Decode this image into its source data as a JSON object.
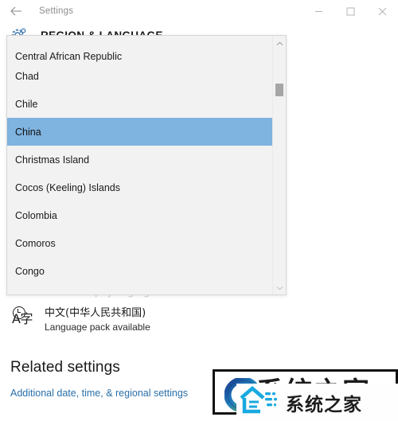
{
  "titlebar": {
    "back_icon": "back-arrow-icon",
    "app_title": "Settings",
    "minimize_icon": "minimize-icon",
    "maximize_icon": "maximize-icon",
    "close_icon": "close-icon"
  },
  "header": {
    "icon": "gear-icon",
    "title": "REGION & LANGUAGE"
  },
  "dropdown": {
    "name": "country-region-dropdown",
    "selected": "China",
    "scroll_up_icon": "chevron-up-icon",
    "scroll_down_icon": "chevron-down-icon",
    "options": [
      "Central African Republic",
      "Chad",
      "Chile",
      "China",
      "Christmas Island",
      "Cocos (Keeling) Islands",
      "Colombia",
      "Comoros",
      "Congo"
    ]
  },
  "content": {
    "clipped_row_label": "Windows display language",
    "language": {
      "icon": "language-character-icon",
      "glyph": "A字",
      "name": "中文(中华人民共和国)",
      "status": "Language pack available"
    },
    "related": {
      "heading": "Related settings",
      "link": "Additional date, time, & regional settings"
    }
  },
  "watermark": {
    "back_text": "系统之家",
    "front_text": "系统之家",
    "ring_icon": "logo-ring-icon",
    "house_icon": "logo-house-icon"
  },
  "colors": {
    "selection_blue": "#7fb3e0",
    "link_blue": "#2a6fa8",
    "accent_blue": "#2f6fad",
    "flyout_bg": "#f2f2f2"
  }
}
